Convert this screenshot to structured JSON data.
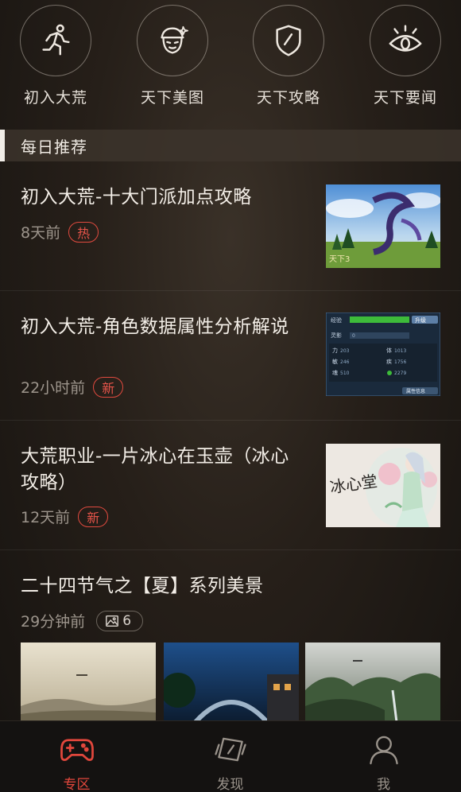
{
  "shortcuts": [
    {
      "label": "初入大荒",
      "icon": "running-person-icon"
    },
    {
      "label": "天下美图",
      "icon": "character-face-icon"
    },
    {
      "label": "天下攻略",
      "icon": "shield-icon"
    },
    {
      "label": "天下要闻",
      "icon": "eye-icon"
    }
  ],
  "section": {
    "title": "每日推荐"
  },
  "articles": [
    {
      "title": "初入大荒-十大门派加点攻略",
      "time": "8天前",
      "badge": "热",
      "thumb": "dragon-artwork-thumbnail"
    },
    {
      "title": "初入大荒-角色数据属性分析解说",
      "time": "22小时前",
      "badge": "新",
      "thumb": "character-stats-thumbnail",
      "thumb_text": {
        "exp": "经验",
        "upgrade": "升级",
        "rows": [
          [
            "力",
            "203",
            "体",
            "1013"
          ],
          [
            "敏",
            "246",
            "疾",
            "1756"
          ],
          [
            "魂",
            "510",
            "",
            "2279"
          ]
        ],
        "footer": "属性信息",
        "row0": "灵影",
        "row0_val": "0"
      }
    },
    {
      "title": "大荒职业-一片冰心在玉壶（冰心攻略）",
      "time": "12天前",
      "badge": "新",
      "thumb": "bingxin-character-thumbnail",
      "thumb_text": "冰心堂"
    },
    {
      "title": "二十四节气之【夏】系列美景",
      "time": "29分钟前",
      "image_count": "6"
    }
  ],
  "tabs": [
    {
      "label": "专区",
      "icon": "gamepad-icon",
      "active": true
    },
    {
      "label": "发现",
      "icon": "discover-cards-icon",
      "active": false
    },
    {
      "label": "我",
      "icon": "user-profile-icon",
      "active": false
    }
  ],
  "colors": {
    "accent": "#e2473c",
    "background": "#1d1915"
  }
}
